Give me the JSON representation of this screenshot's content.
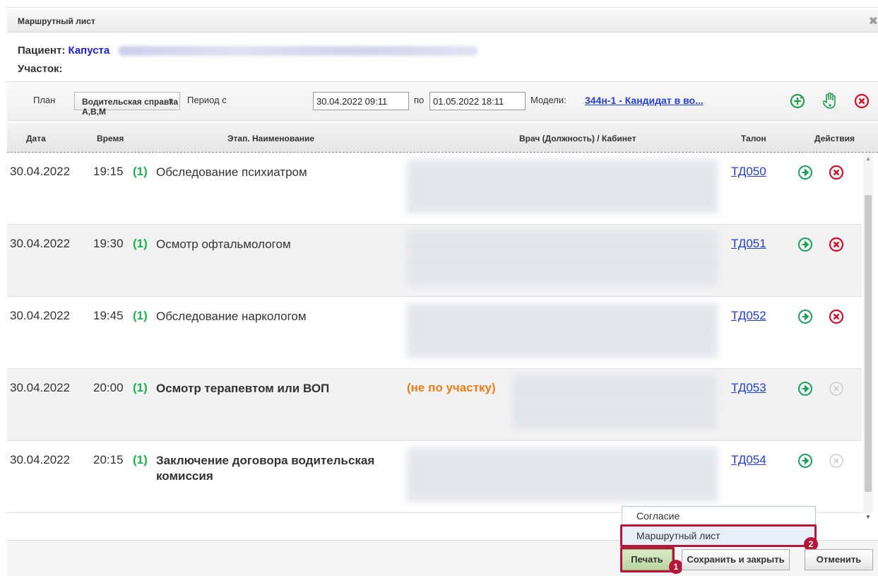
{
  "window": {
    "title": "Маршрутный лист",
    "close_icon": "close-icon"
  },
  "patient": {
    "label": "Пациент:",
    "name": "Капуста",
    "uchastok_label": "Участок:"
  },
  "plan": {
    "label": "План",
    "selected": "Водительская справка А,В,М",
    "period_from_label": "Период с",
    "period_from": "30.04.2022 09:11",
    "period_to_label": "по",
    "period_to": "01.05.2022 18:11",
    "models_label": "Модели:",
    "models_value": "344н-1 - Кандидат в во...",
    "icons": [
      "add-circle-icon",
      "hand-icon",
      "delete-icon"
    ]
  },
  "table": {
    "headers": [
      "Дата",
      "Время",
      "Этап. Наименование",
      "Врач (Должность) / Кабинет",
      "Талон",
      "Действия"
    ],
    "rows": [
      {
        "date": "30.04.2022",
        "time": "19:15",
        "stage": "(1)",
        "name": "Обследование психиатром",
        "not_area": "",
        "talon": "ТД050",
        "deletable": true
      },
      {
        "date": "30.04.2022",
        "time": "19:30",
        "stage": "(1)",
        "name": "Осмотр офтальмологом",
        "not_area": "",
        "talon": "ТД051",
        "deletable": true
      },
      {
        "date": "30.04.2022",
        "time": "19:45",
        "stage": "(1)",
        "name": "Обследование наркологом",
        "not_area": "",
        "talon": "ТД052",
        "deletable": true
      },
      {
        "date": "30.04.2022",
        "time": "20:00",
        "stage": "(1)",
        "name": "Осмотр терапевтом или ВОП",
        "not_area": "(не по участку)",
        "talon": "ТД053",
        "deletable": false
      },
      {
        "date": "30.04.2022",
        "time": "20:15",
        "stage": "(1)",
        "name": "Заключение договора водительская комиссия",
        "not_area": "",
        "talon": "ТД054",
        "deletable": false
      }
    ]
  },
  "print_menu": {
    "items": [
      "Согласие",
      "Маршрутный лист"
    ],
    "highlighted": 1
  },
  "footer": {
    "print": "Печать",
    "save_close": "Сохранить и закрыть",
    "cancel": "Отменить"
  },
  "badges": {
    "one": "1",
    "two": "2"
  },
  "colors": {
    "accent_red": "#b5173a",
    "link_blue": "#2240d8",
    "green": "#20b050",
    "orange": "#f07d1a"
  }
}
